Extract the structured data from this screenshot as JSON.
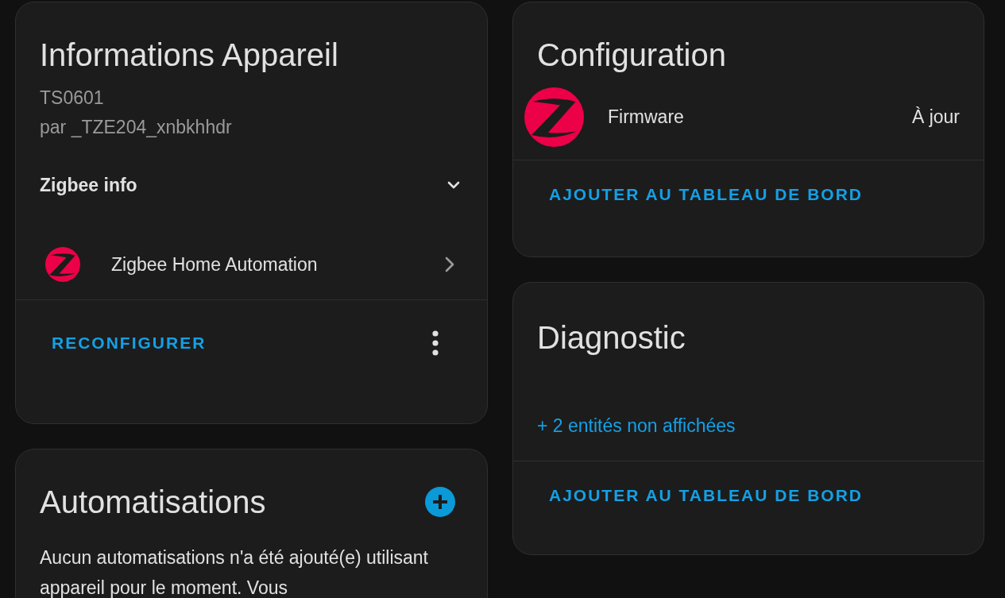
{
  "device_info": {
    "title": "Informations Appareil",
    "model": "TS0601",
    "manufacturer": "par _TZE204_xnbkhhdr",
    "zigbee_info": {
      "label": "Zigbee info",
      "expanded": false
    },
    "integration": {
      "name": "Zigbee Home Automation"
    },
    "button": "RECONFIGURER"
  },
  "automations": {
    "title": "Automatisations",
    "message": "Aucun automatisations n'a été ajouté(e) utilisant appareil pour le moment. Vous"
  },
  "configuration": {
    "title": "Configuration",
    "entities": [
      {
        "name": "Firmware",
        "state": "À jour"
      }
    ],
    "button": "AJOUTER AU TABLEAU DE BORD"
  },
  "diagnostic": {
    "title": "Diagnostic",
    "hidden_entities": "+ 2 entités non affichées",
    "button": "AJOUTER AU TABLEAU DE BORD"
  }
}
